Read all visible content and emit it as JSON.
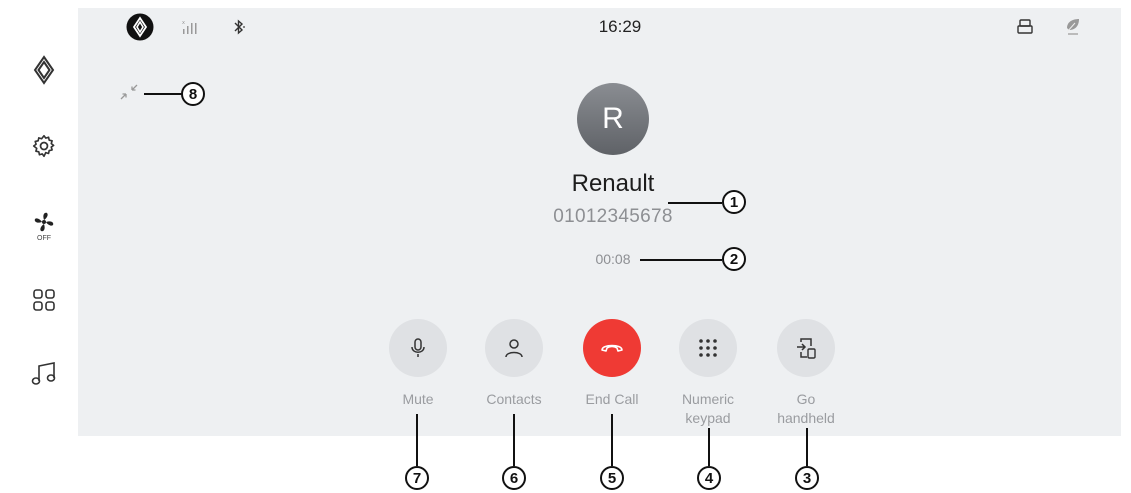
{
  "status_bar": {
    "time": "16:29",
    "icons": [
      "renault-logo-icon",
      "signal-icon",
      "bluetooth-icon",
      "usb-icon",
      "eco-icon"
    ]
  },
  "sidebar": {
    "items": [
      {
        "name": "renault-home",
        "icon": "renault-logo-icon"
      },
      {
        "name": "settings",
        "icon": "gear-icon"
      },
      {
        "name": "climate",
        "icon": "fan-icon",
        "label": "OFF"
      },
      {
        "name": "apps",
        "icon": "grid-icon"
      },
      {
        "name": "media",
        "icon": "music-note-icon"
      }
    ]
  },
  "call": {
    "avatar_initial": "R",
    "contact_name": "Renault",
    "phone_number": "01012345678",
    "duration": "00:08"
  },
  "actions": [
    {
      "label": "Mute",
      "icon": "microphone-icon"
    },
    {
      "label": "Contacts",
      "icon": "person-icon"
    },
    {
      "label": "End Call",
      "icon": "hang-up-icon",
      "color": "#ef3a34"
    },
    {
      "label": "Numeric keypad",
      "icon": "keypad-icon"
    },
    {
      "label": "Go handheld",
      "icon": "phone-transfer-icon"
    }
  ],
  "callouts": [
    "1",
    "2",
    "3",
    "4",
    "5",
    "6",
    "7",
    "8"
  ]
}
